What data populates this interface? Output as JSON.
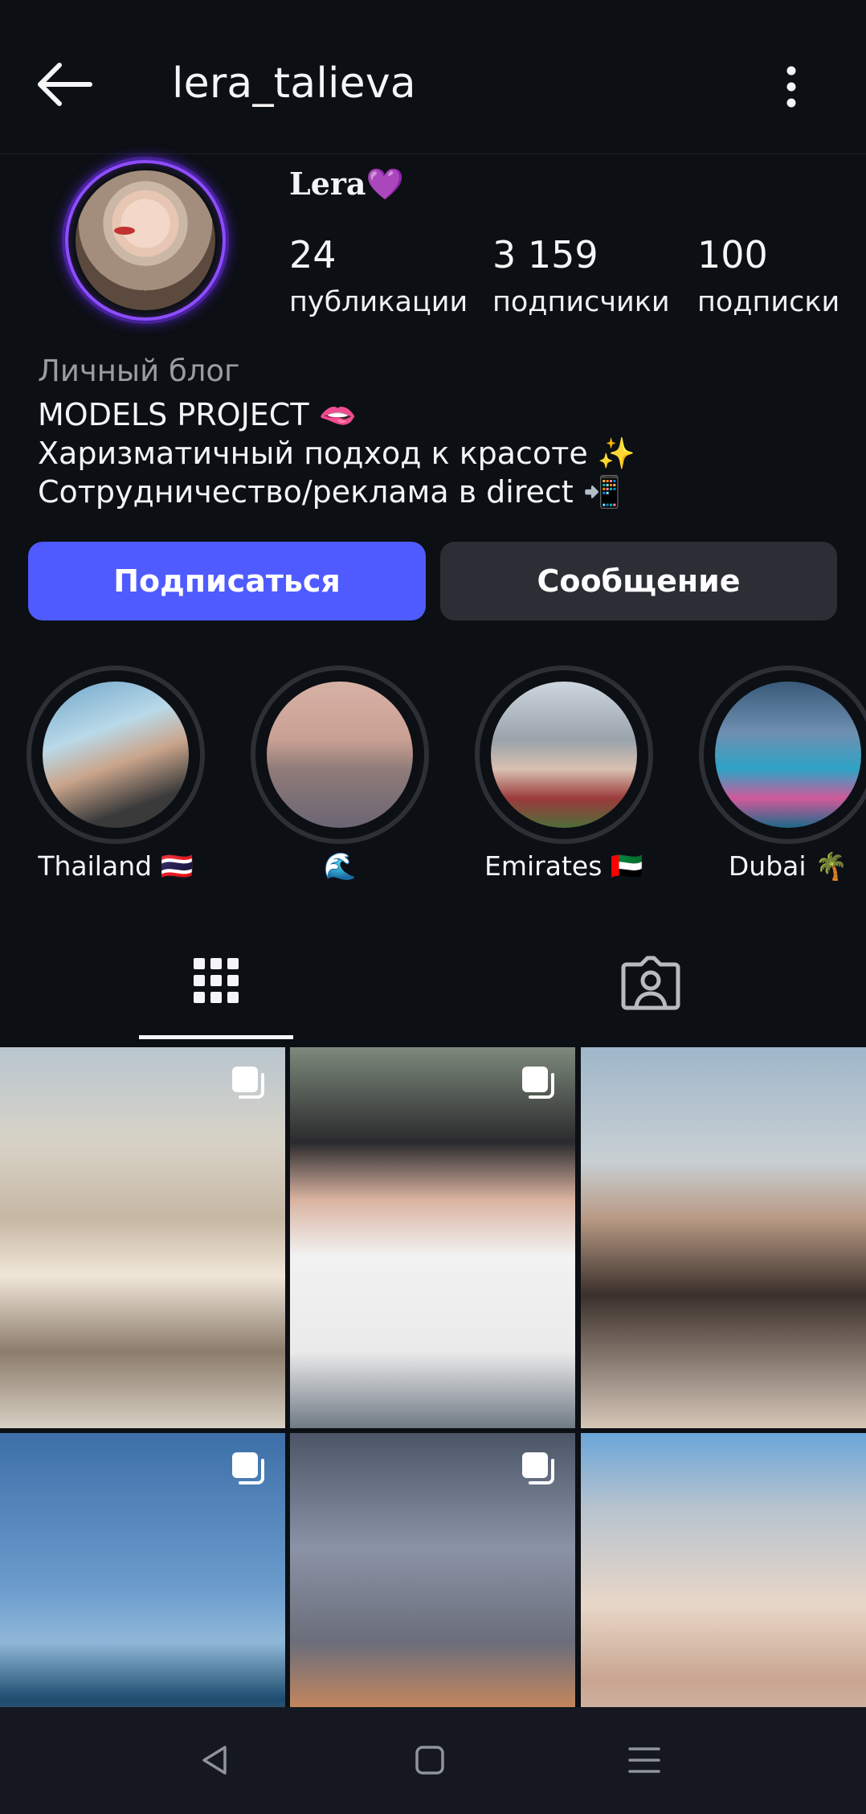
{
  "header": {
    "username": "lera_talieva",
    "back_icon": "arrow-left-icon",
    "menu_icon": "more-vertical-icon"
  },
  "profile": {
    "display_name": "Lera💜",
    "stats": [
      {
        "value": "24",
        "label": "публикации"
      },
      {
        "value": "3 159",
        "label": "подписчики"
      },
      {
        "value": "100",
        "label": "подписки"
      }
    ],
    "bio_category": "Личный блог",
    "bio_lines": [
      "MODELS  PROJECT 🫦",
      "Харизматичный подход к красоте ✨",
      "Сотрудничество/реклама в direct 📲"
    ]
  },
  "actions": {
    "follow_label": "Подписаться",
    "message_label": "Сообщение",
    "follow_color": "#4f5bff"
  },
  "highlights": [
    {
      "label": "Thailand 🇹🇭"
    },
    {
      "label": "🌊"
    },
    {
      "label": "Emirates 🇦🇪"
    },
    {
      "label": "Dubai 🌴"
    }
  ],
  "tabs": {
    "active": "grid",
    "items": [
      "grid-icon",
      "tagged-icon"
    ]
  },
  "posts": [
    {
      "multi": true
    },
    {
      "multi": true
    },
    {
      "multi": false
    },
    {
      "multi": true
    },
    {
      "multi": true
    },
    {
      "multi": false
    }
  ],
  "system_nav": [
    "back-triangle-icon",
    "home-square-icon",
    "menu-lines-icon"
  ],
  "colors": {
    "background": "#0c0f14",
    "secondary_button": "#2b2e35",
    "avatar_ring": "#8d4dff"
  }
}
